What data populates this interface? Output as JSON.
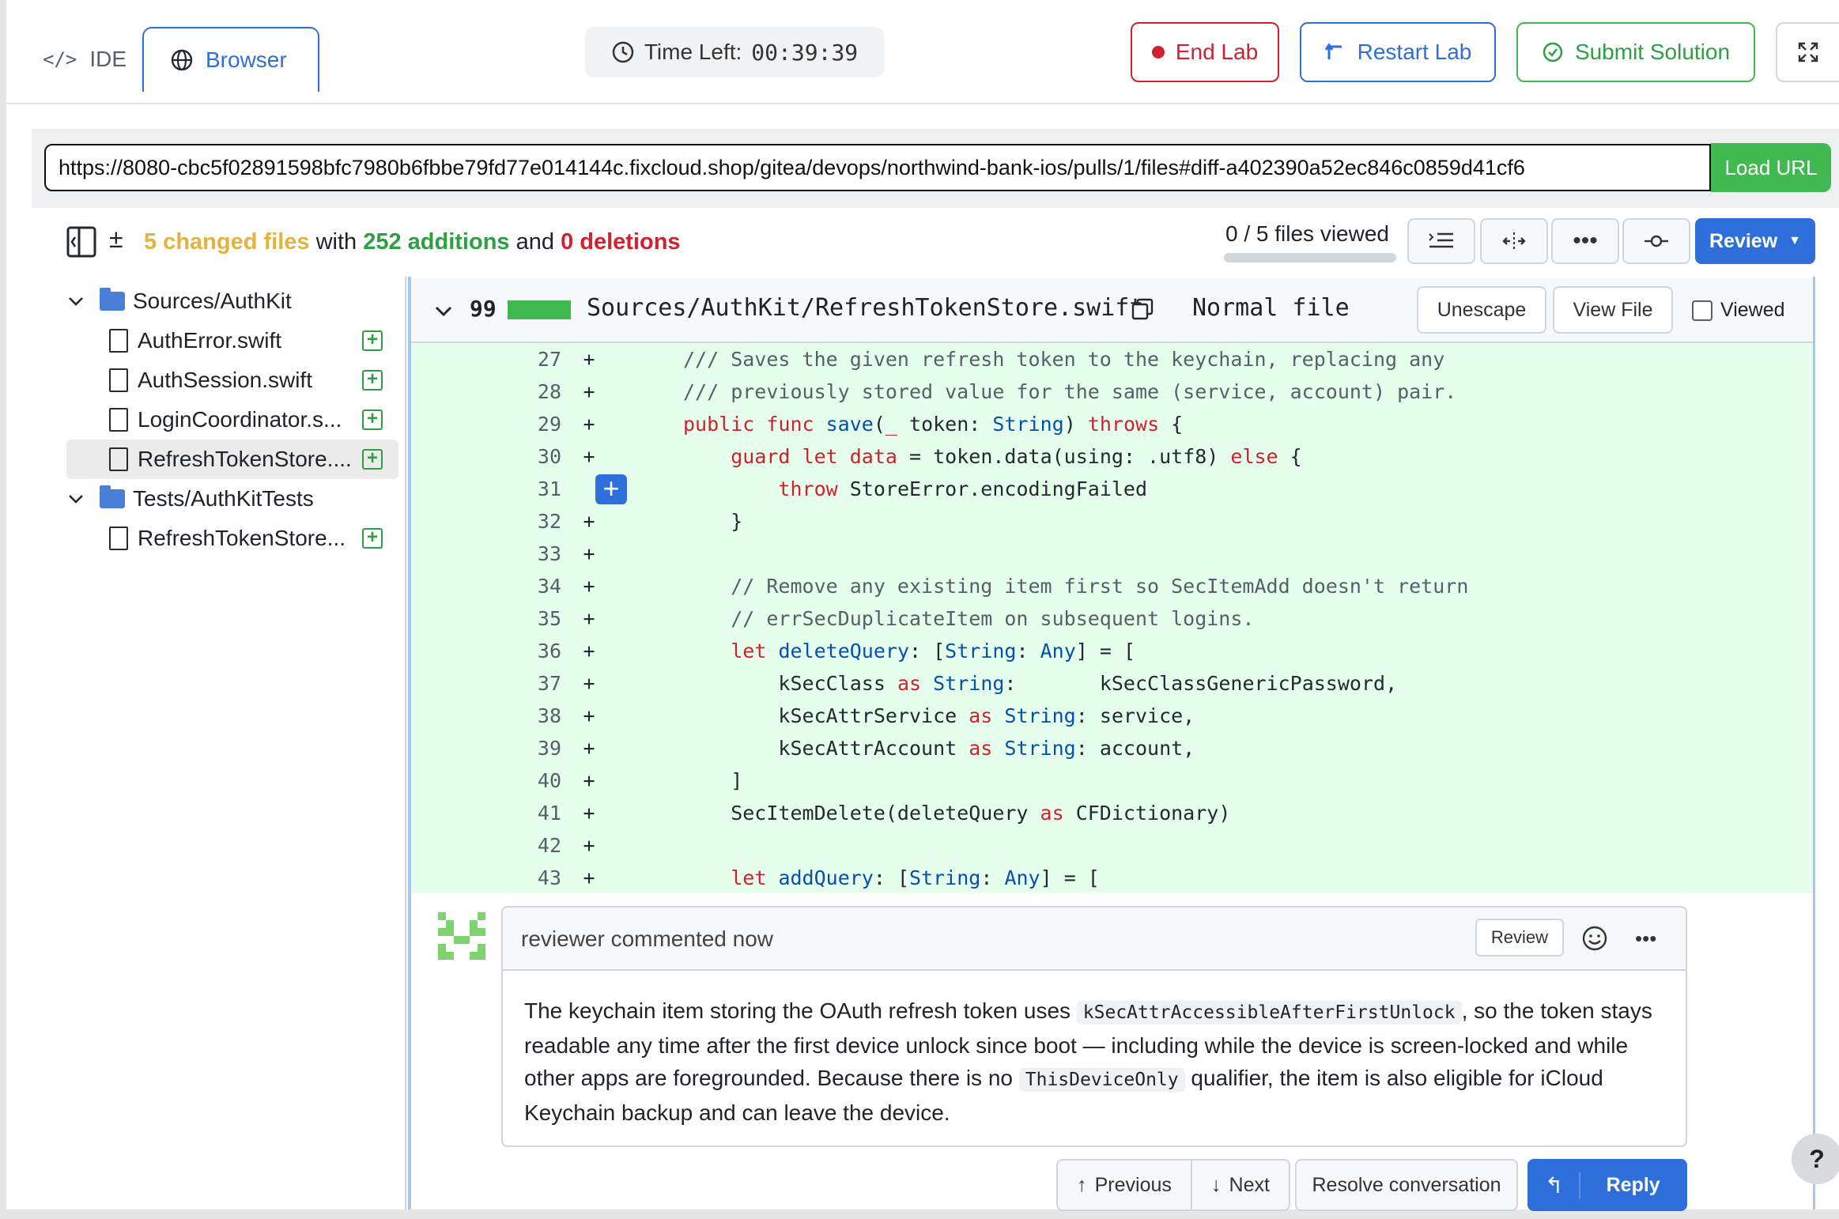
{
  "tabs": [
    {
      "label": "IDE",
      "icon": "code-icon"
    },
    {
      "label": "Browser",
      "icon": "globe-icon"
    }
  ],
  "timer": {
    "label": "Time Left:",
    "value": "00:39:39"
  },
  "lab_buttons": {
    "end": "End Lab",
    "restart": "Restart Lab",
    "submit": "Submit Solution"
  },
  "url": {
    "value": "https://8080-cbc5f02891598bfc7980b6fbbe79fd77e014144c.fixcloud.shop/gitea/devops/northwind-bank-ios/pulls/1/files#diff-a402390a52ec846c0859d41cf6",
    "button": "Load URL"
  },
  "diff_summary": {
    "changed": "5 changed files",
    "with": "with",
    "additions": "252 additions",
    "and": "and",
    "deletions": "0 deletions",
    "viewed": "0 / 5 files viewed",
    "review": "Review"
  },
  "tree": {
    "folder1": "Sources/AuthKit",
    "files1": [
      "AuthError.swift",
      "AuthSession.swift",
      "LoginCoordinator.s...",
      "RefreshTokenStore...."
    ],
    "folder2": "Tests/AuthKitTests",
    "files2": [
      "RefreshTokenStore..."
    ]
  },
  "file": {
    "count": "99",
    "path": "Sources/AuthKit/RefreshTokenStore.swift",
    "mode": "Normal file",
    "unescape": "Unescape",
    "view_file": "View File",
    "viewed": "Viewed"
  },
  "code_lines": [
    {
      "n": "27",
      "sign": "+",
      "parts": [
        [
          "cm",
          "/// Saves the given refresh token to the keychain, replacing any"
        ]
      ]
    },
    {
      "n": "28",
      "sign": "+",
      "parts": [
        [
          "cm",
          "/// previously stored value for the same (service, account) pair."
        ]
      ]
    },
    {
      "n": "29",
      "sign": "+",
      "parts": [
        [
          "kw",
          "public func "
        ],
        [
          "fn",
          "save"
        ],
        [
          "",
          "("
        ],
        [
          "kw",
          "_"
        ],
        [
          "",
          " token: "
        ],
        [
          "ty",
          "String"
        ],
        [
          "",
          ") "
        ],
        [
          "kw",
          "throws"
        ],
        [
          "",
          " {"
        ]
      ]
    },
    {
      "n": "30",
      "sign": "+",
      "parts": [
        [
          "",
          "    "
        ],
        [
          "kw",
          "guard let"
        ],
        [
          "",
          " "
        ],
        [
          "kw",
          "data"
        ],
        [
          "",
          " = token.data(using: .utf8) "
        ],
        [
          "kw",
          "else"
        ],
        [
          "",
          " {"
        ]
      ]
    },
    {
      "n": "31",
      "sign": "",
      "parts": [
        [
          "",
          "        "
        ],
        [
          "kw",
          "throw"
        ],
        [
          "",
          " StoreError.encodingFailed"
        ]
      ]
    },
    {
      "n": "32",
      "sign": "+",
      "parts": [
        [
          "",
          "    }"
        ]
      ]
    },
    {
      "n": "33",
      "sign": "+",
      "parts": [
        [
          "",
          ""
        ]
      ]
    },
    {
      "n": "34",
      "sign": "+",
      "parts": [
        [
          "cm",
          "    // Remove any existing item first so SecItemAdd doesn't return"
        ]
      ]
    },
    {
      "n": "35",
      "sign": "+",
      "parts": [
        [
          "cm",
          "    // errSecDuplicateItem on subsequent logins."
        ]
      ]
    },
    {
      "n": "36",
      "sign": "+",
      "parts": [
        [
          "",
          "    "
        ],
        [
          "kw",
          "let"
        ],
        [
          "",
          " "
        ],
        [
          "fn",
          "deleteQuery"
        ],
        [
          "",
          ": ["
        ],
        [
          "ty",
          "String"
        ],
        [
          "",
          ": "
        ],
        [
          "ty",
          "Any"
        ],
        [
          "",
          "] = ["
        ]
      ]
    },
    {
      "n": "37",
      "sign": "+",
      "parts": [
        [
          "",
          "        kSecClass "
        ],
        [
          "kw",
          "as"
        ],
        [
          "",
          " "
        ],
        [
          "ty",
          "String"
        ],
        [
          "",
          ":       kSecClassGenericPassword,"
        ]
      ]
    },
    {
      "n": "38",
      "sign": "+",
      "parts": [
        [
          "",
          "        kSecAttrService "
        ],
        [
          "kw",
          "as"
        ],
        [
          "",
          " "
        ],
        [
          "ty",
          "String"
        ],
        [
          "",
          ": service,"
        ]
      ]
    },
    {
      "n": "39",
      "sign": "+",
      "parts": [
        [
          "",
          "        kSecAttrAccount "
        ],
        [
          "kw",
          "as"
        ],
        [
          "",
          " "
        ],
        [
          "ty",
          "String"
        ],
        [
          "",
          ": account,"
        ]
      ]
    },
    {
      "n": "40",
      "sign": "+",
      "parts": [
        [
          "",
          "    ]"
        ]
      ]
    },
    {
      "n": "41",
      "sign": "+",
      "parts": [
        [
          "",
          "    SecItemDelete(deleteQuery "
        ],
        [
          "kw",
          "as"
        ],
        [
          "",
          " CFDictionary)"
        ]
      ]
    },
    {
      "n": "42",
      "sign": "+",
      "parts": [
        [
          "",
          ""
        ]
      ]
    },
    {
      "n": "43",
      "sign": "+",
      "parts": [
        [
          "",
          "    "
        ],
        [
          "kw",
          "let"
        ],
        [
          "",
          " "
        ],
        [
          "fn",
          "addQuery"
        ],
        [
          "",
          ": ["
        ],
        [
          "ty",
          "String"
        ],
        [
          "",
          ": "
        ],
        [
          "ty",
          "Any"
        ],
        [
          "",
          "] = ["
        ]
      ]
    }
  ],
  "comment": {
    "header": "reviewer commented now",
    "review_btn": "Review",
    "body_1": "The keychain item storing the OAuth refresh token uses ",
    "code_1": "kSecAttrAccessibleAfterFirstUnlock",
    "body_2": ", so the token stays readable any time after the first device unlock since boot — including while the device is screen-locked and while other apps are foregrounded. Because there is no ",
    "code_2": "ThisDeviceOnly",
    "body_3": " qualifier, the item is also eligible for iCloud Keychain backup and can leave the device."
  },
  "footer": {
    "previous": "Previous",
    "next": "Next",
    "resolve": "Resolve conversation",
    "reply": "Reply"
  },
  "help": "?",
  "colors": {
    "accent": "#2f6fdb",
    "add_bg": "#e6ffec",
    "green": "#3fb950",
    "danger": "#cf222e"
  }
}
